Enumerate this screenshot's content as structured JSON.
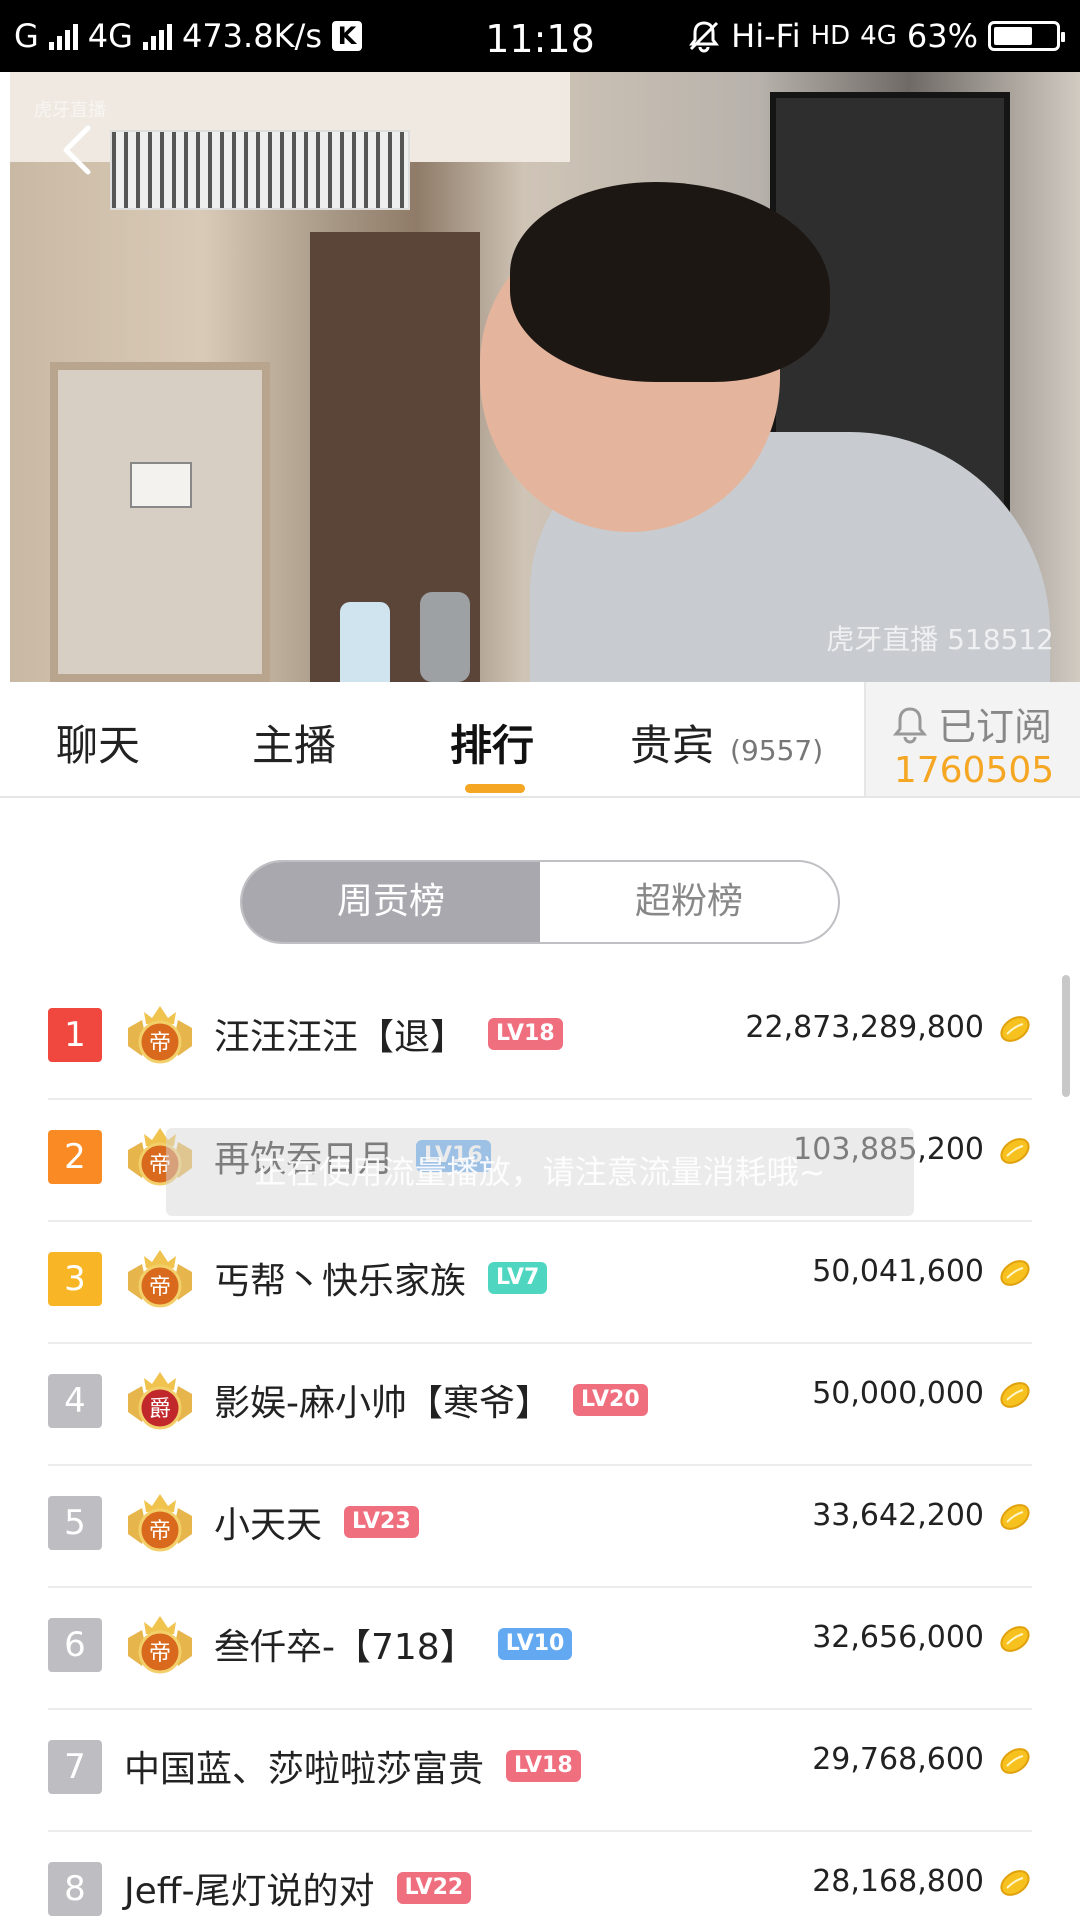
{
  "status_bar": {
    "carrier": "G",
    "network": "4G",
    "speed": "473.8K/s",
    "k_badge": "K",
    "time": "11:18",
    "hifi": "Hi-Fi",
    "hd": "HD",
    "network2": "4G",
    "battery_percent": "63%",
    "battery_level": 0.63
  },
  "video": {
    "watermark_bottom": "虎牙直播 518512",
    "watermark_top": "虎牙直播"
  },
  "tabs": [
    {
      "label": "聊天",
      "active": false
    },
    {
      "label": "主播",
      "active": false
    },
    {
      "label": "排行",
      "active": true
    },
    {
      "label": "贵宾",
      "count": "(9557)",
      "active": false
    }
  ],
  "subscribe": {
    "label": "已订阅",
    "count": "1760505"
  },
  "toggle": {
    "options": [
      "周贡榜",
      "超粉榜"
    ],
    "selected": "周贡榜"
  },
  "toast": "正在使用流量播放，请注意流量消耗哦~",
  "rankings": [
    {
      "rank": "1",
      "rank_color": "#f0483e",
      "medal": "帝",
      "medal_color": "#d9691c",
      "name": "汪汪汪汪【退】",
      "level": "LV18",
      "level_color": "#ef6f7f",
      "score": "22,873,289,800"
    },
    {
      "rank": "2",
      "rank_color": "#fa8b24",
      "medal": "帝",
      "medal_color": "#d9691c",
      "name": "再饮吞日月",
      "level": "LV16",
      "level_color": "#63a9f2",
      "score": "103,885,200"
    },
    {
      "rank": "3",
      "rank_color": "#f8b627",
      "medal": "帝",
      "medal_color": "#d9691c",
      "name": "丐帮丶快乐家族",
      "level": "LV7",
      "level_color": "#4fd6c1",
      "score": "50,041,600"
    },
    {
      "rank": "4",
      "rank_color": "#bdbdc2",
      "medal": "爵",
      "medal_color": "#c0282b",
      "name": "影娱-麻小帅【寒爷】",
      "level": "LV20",
      "level_color": "#ef6f7f",
      "score": "50,000,000"
    },
    {
      "rank": "5",
      "rank_color": "#bdbdc2",
      "medal": "帝",
      "medal_color": "#d9691c",
      "name": "小天天",
      "level": "LV23",
      "level_color": "#ef6f7f",
      "score": "33,642,200"
    },
    {
      "rank": "6",
      "rank_color": "#bdbdc2",
      "medal": "帝",
      "medal_color": "#d9691c",
      "name": "叁仟卒-【718】",
      "level": "LV10",
      "level_color": "#63a9f2",
      "score": "32,656,000"
    },
    {
      "rank": "7",
      "rank_color": "#bdbdc2",
      "medal": "",
      "medal_color": "",
      "name": "中国蓝、莎啦啦莎富贵",
      "level": "LV18",
      "level_color": "#ef6f7f",
      "score": "29,768,600"
    },
    {
      "rank": "8",
      "rank_color": "#bdbdc2",
      "medal": "",
      "medal_color": "",
      "name": "Jeff-尾灯说的对",
      "level": "LV22",
      "level_color": "#ef6f7f",
      "score": "28,168,800"
    }
  ],
  "icons": {
    "back": "back-arrow-icon",
    "bell": "bell-icon",
    "coin": "gold-bean-icon",
    "mute": "mute-bell-icon",
    "signal": "signal-bars-icon",
    "battery": "battery-icon"
  }
}
